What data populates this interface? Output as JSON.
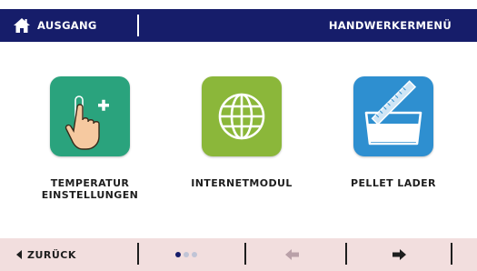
{
  "header": {
    "exit_label": "AUSGANG",
    "menu_title": "HANDWERKERMENÜ",
    "home_icon": "home-icon"
  },
  "tiles": [
    {
      "label_line1": "TEMPERATUR",
      "label_line2": "EINSTELLUNGEN",
      "color": "#2aa37d",
      "icon": "touch-plus-icon"
    },
    {
      "label_line1": "INTERNETMODUL",
      "label_line2": "",
      "color": "#8bb73a",
      "icon": "globe-icon"
    },
    {
      "label_line1": "PELLET LADER",
      "label_line2": "",
      "color": "#2e8fd0",
      "icon": "pellet-container-icon"
    }
  ],
  "footer": {
    "back_label": "ZURÜCK",
    "page_indicator": {
      "total": 3,
      "active": 1
    },
    "prev_enabled": false,
    "next_enabled": true
  },
  "colors": {
    "header_bg": "#161d6a",
    "footer_bg": "#f2dede",
    "text": "#1e1e1e"
  }
}
